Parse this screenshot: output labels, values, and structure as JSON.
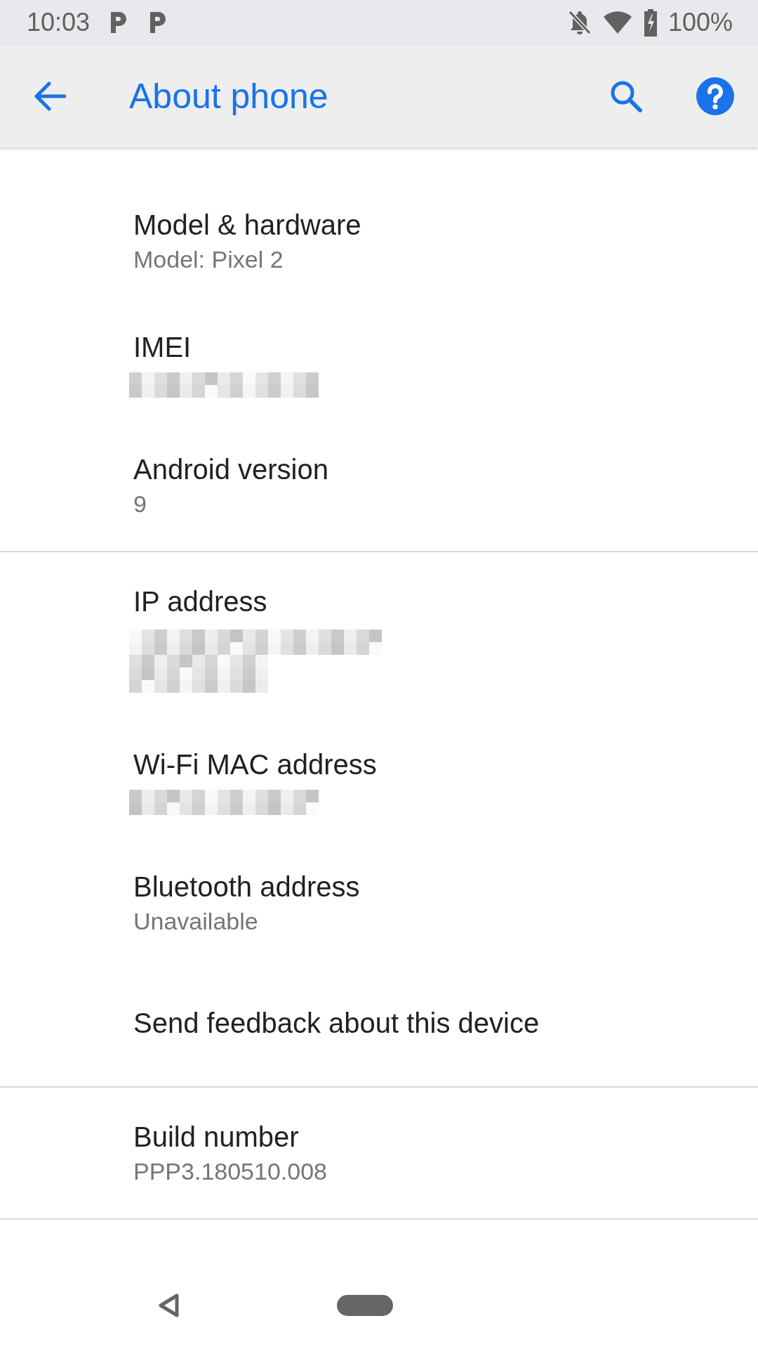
{
  "status_bar": {
    "time": "10:03",
    "battery": "100%"
  },
  "app_bar": {
    "title": "About phone"
  },
  "sections": [
    {
      "items": [
        {
          "kind": "text",
          "title": "Model & hardware",
          "summary": "Model: Pixel 2"
        },
        {
          "kind": "redacted-short",
          "title": "IMEI"
        },
        {
          "kind": "text",
          "title": "Android version",
          "summary": "9"
        }
      ]
    },
    {
      "items": [
        {
          "kind": "redacted-long",
          "title": "IP address"
        },
        {
          "kind": "redacted-short",
          "title": "Wi-Fi MAC address"
        },
        {
          "kind": "text",
          "title": "Bluetooth address",
          "summary": "Unavailable"
        },
        {
          "kind": "plain",
          "title": "Send feedback about this device"
        }
      ]
    },
    {
      "items": [
        {
          "kind": "text",
          "title": "Build number",
          "summary": "PPP3.180510.008"
        }
      ]
    }
  ]
}
